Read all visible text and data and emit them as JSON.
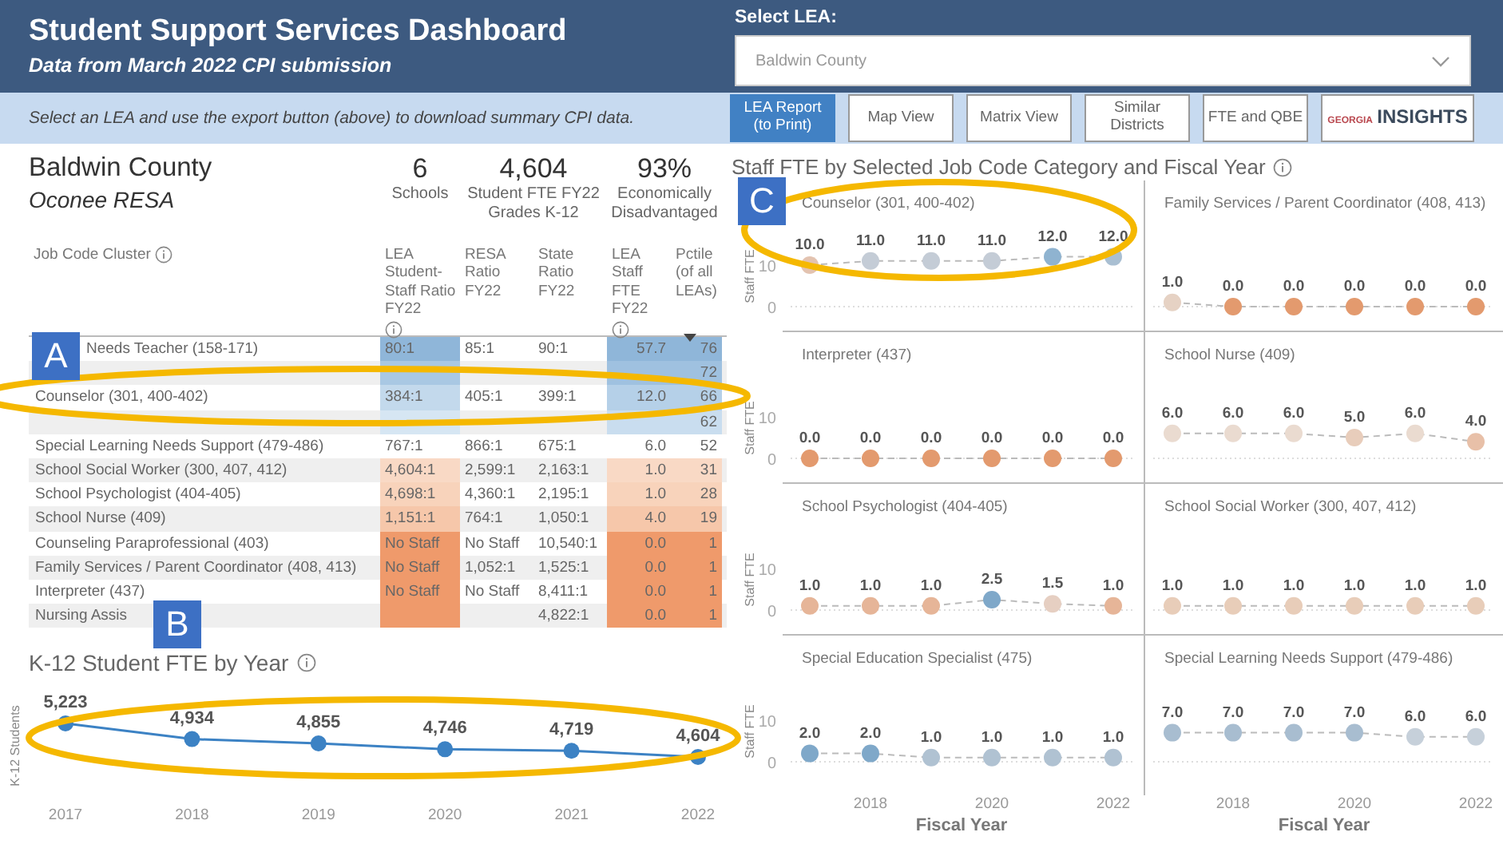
{
  "header": {
    "title": "Student Support Services Dashboard",
    "subtitle": "Data from March 2022 CPI submission"
  },
  "lea_select": {
    "label": "Select LEA:",
    "value": "Baldwin County"
  },
  "instructions": "Select an LEA and use the export button (above) to download summary CPI data.",
  "nav_buttons": [
    {
      "kind": "button",
      "label": "LEA Report (to Print)",
      "selected": true
    },
    {
      "kind": "button",
      "label": "Map View",
      "selected": false
    },
    {
      "kind": "button",
      "label": "Matrix View",
      "selected": false
    },
    {
      "kind": "button",
      "label": "Similar Districts",
      "selected": false
    },
    {
      "kind": "button",
      "label": "FTE and QBE",
      "selected": false
    },
    {
      "kind": "logo",
      "label_small": "GEORGIA",
      "label_large": "INSIGHTS",
      "selected": false
    }
  ],
  "summary": {
    "name": "Baldwin County",
    "resa": "Oconee RESA",
    "stats": [
      {
        "value": "6",
        "label": "Schools"
      },
      {
        "value": "4,604",
        "label": "Student FTE FY22 Grades K-12"
      },
      {
        "value": "93%",
        "label": "Economically Disadvantaged"
      }
    ]
  },
  "table": {
    "columns": [
      {
        "label": "Job Code Cluster",
        "info": true,
        "sorted": false
      },
      {
        "label": "LEA Student-Staff Ratio FY22",
        "info": true,
        "sorted": false
      },
      {
        "label": "RESA Ratio FY22",
        "info": false,
        "sorted": false
      },
      {
        "label": "State Ratio FY22",
        "info": false,
        "sorted": false
      },
      {
        "label": "LEA Staff FTE FY22",
        "info": true,
        "sorted": false
      },
      {
        "label": "Pctile (of all LEAs)",
        "info": false,
        "sorted": true
      }
    ],
    "rows": [
      {
        "cells": [
          {
            "text": "Needs Teacher (158-171)"
          },
          {
            "text": "80:1",
            "color": "#8fb6d9"
          },
          {
            "text": "85:1"
          },
          {
            "text": "90:1"
          },
          {
            "text": "57.7",
            "color": "#8fb6d9"
          },
          {
            "text": "76",
            "color": "#8fb6d9"
          }
        ]
      },
      {
        "cells": [
          {},
          {
            "color": "#a9c8e3"
          },
          {},
          {},
          {
            "color": "#9fc1e0"
          },
          {
            "text": "72",
            "color": "#9fc1e0"
          }
        ]
      },
      {
        "cells": [
          {
            "text": "Counselor (301, 400-402)"
          },
          {
            "text": "384:1",
            "color": "#c3d9ec"
          },
          {
            "text": "405:1"
          },
          {
            "text": "399:1"
          },
          {
            "text": "12.0",
            "color": "#b5d0e8"
          },
          {
            "text": "66",
            "color": "#b5d0e8"
          }
        ]
      },
      {
        "cells": [
          {},
          {
            "color": "#d6e6f3"
          },
          {},
          {},
          {
            "color": "#c9ddef"
          },
          {
            "text": "62",
            "color": "#c9ddef"
          }
        ]
      },
      {
        "cells": [
          {
            "text": "Special Learning Needs Support (479-486)"
          },
          {
            "text": "767:1",
            "color": "#ffffff"
          },
          {
            "text": "866:1"
          },
          {
            "text": "675:1"
          },
          {
            "text": "6.0",
            "color": "#ffffff"
          },
          {
            "text": "52",
            "color": "#ffffff"
          }
        ]
      },
      {
        "cells": [
          {
            "text": "School Social Worker (300, 407, 412)"
          },
          {
            "text": "4,604:1",
            "color": "#f9d9c5"
          },
          {
            "text": "2,599:1"
          },
          {
            "text": "2,163:1"
          },
          {
            "text": "1.0",
            "color": "#f9d9c5"
          },
          {
            "text": "31",
            "color": "#f9d9c5"
          }
        ]
      },
      {
        "cells": [
          {
            "text": "School Psychologist (404-405)"
          },
          {
            "text": "4,698:1",
            "color": "#f8d3bb"
          },
          {
            "text": "4,360:1"
          },
          {
            "text": "2,195:1"
          },
          {
            "text": "1.0",
            "color": "#f8d3bb"
          },
          {
            "text": "28",
            "color": "#f8d3bb"
          }
        ]
      },
      {
        "cells": [
          {
            "text": "School Nurse (409)"
          },
          {
            "text": "1,151:1",
            "color": "#f6c7aa"
          },
          {
            "text": "764:1"
          },
          {
            "text": "1,050:1"
          },
          {
            "text": "4.0",
            "color": "#f6c7aa"
          },
          {
            "text": "19",
            "color": "#f6c7aa"
          }
        ]
      },
      {
        "cells": [
          {
            "text": "Counseling Paraprofessional (403)"
          },
          {
            "text": "No Staff",
            "color": "#ef9a6b"
          },
          {
            "text": "No Staff"
          },
          {
            "text": "10,540:1"
          },
          {
            "text": "0.0",
            "color": "#ef9a6b"
          },
          {
            "text": "1",
            "color": "#ef9a6b"
          }
        ]
      },
      {
        "cells": [
          {
            "text": "Family Services / Parent Coordinator (408, 413)"
          },
          {
            "text": "No Staff",
            "color": "#ef9a6b"
          },
          {
            "text": "1,052:1"
          },
          {
            "text": "1,525:1"
          },
          {
            "text": "0.0",
            "color": "#ef9a6b"
          },
          {
            "text": "1",
            "color": "#ef9a6b"
          }
        ]
      },
      {
        "cells": [
          {
            "text": "Interpreter (437)"
          },
          {
            "text": "No Staff",
            "color": "#ef9a6b"
          },
          {
            "text": "No Staff"
          },
          {
            "text": "8,411:1"
          },
          {
            "text": "0.0",
            "color": "#ef9a6b"
          },
          {
            "text": "1",
            "color": "#ef9a6b"
          }
        ]
      },
      {
        "cells": [
          {
            "text": "Nursing Assis"
          },
          {
            "color": "#ef9a6b"
          },
          {},
          {
            "text": "4,822:1"
          },
          {
            "text": "0.0",
            "color": "#ef9a6b"
          },
          {
            "text": "1",
            "color": "#ef9a6b"
          }
        ]
      }
    ]
  },
  "k12_chart": {
    "chart_data": {
      "type": "line",
      "title": "K-12 Student FTE by Year",
      "ylabel": "K-12 Students",
      "categories": [
        "2017",
        "2018",
        "2019",
        "2020",
        "2021",
        "2022"
      ],
      "values": [
        5223,
        4934,
        4855,
        4746,
        4719,
        4604
      ],
      "color": "#3c82c4",
      "marker": "circle",
      "value_labels": [
        "5,223",
        "4,934",
        "4,855",
        "4,746",
        "4,719",
        "4,604"
      ]
    }
  },
  "staff_fte": {
    "title": "Staff FTE by Selected Job Code Category and Fiscal Year",
    "panels": [
      {
        "title": "Counselor (301, 400-402)",
        "y_axis": {
          "label": "Staff FTE",
          "ticks": [
            "10",
            "0"
          ]
        },
        "points": [
          {
            "label": "10.0",
            "color": "#e3c3b0"
          },
          {
            "label": "11.0",
            "color": "#c4ccd6"
          },
          {
            "label": "11.0",
            "color": "#c4ccd6"
          },
          {
            "label": "11.0",
            "color": "#c4ccd6"
          },
          {
            "label": "12.0",
            "color": "#8fb3d0"
          },
          {
            "label": "12.0",
            "color": "#a9bfd2"
          }
        ]
      },
      {
        "title": "Family Services / Parent Coordinator (408, 413)",
        "points": [
          {
            "label": "1.0",
            "color": "#e6d2c4"
          },
          {
            "label": "0.0",
            "color": "#e39a6e"
          },
          {
            "label": "0.0",
            "color": "#e39a6e"
          },
          {
            "label": "0.0",
            "color": "#e39a6e"
          },
          {
            "label": "0.0",
            "color": "#e39a6e"
          },
          {
            "label": "0.0",
            "color": "#e39a6e"
          }
        ]
      },
      {
        "title": "Interpreter (437)",
        "y_axis": {
          "label": "Staff FTE",
          "ticks": [
            "10",
            "0"
          ]
        },
        "points": [
          {
            "label": "0.0",
            "color": "#e39a6e"
          },
          {
            "label": "0.0",
            "color": "#e39a6e"
          },
          {
            "label": "0.0",
            "color": "#e39a6e"
          },
          {
            "label": "0.0",
            "color": "#e39a6e"
          },
          {
            "label": "0.0",
            "color": "#e39a6e"
          },
          {
            "label": "0.0",
            "color": "#e39a6e"
          }
        ]
      },
      {
        "title": "School Nurse (409)",
        "points": [
          {
            "label": "6.0",
            "color": "#eadbd0"
          },
          {
            "label": "6.0",
            "color": "#eadbd0"
          },
          {
            "label": "6.0",
            "color": "#eadbd0"
          },
          {
            "label": "5.0",
            "color": "#e8cdbb"
          },
          {
            "label": "6.0",
            "color": "#eadbd0"
          },
          {
            "label": "4.0",
            "color": "#e8c0a8"
          }
        ]
      },
      {
        "title": "School Psychologist (404-405)",
        "y_axis": {
          "label": "Staff FTE",
          "ticks": [
            "10",
            "0"
          ]
        },
        "points": [
          {
            "label": "1.0",
            "color": "#e6b598"
          },
          {
            "label": "1.0",
            "color": "#e6b598"
          },
          {
            "label": "1.0",
            "color": "#e6b598"
          },
          {
            "label": "2.5",
            "color": "#7fa8c9"
          },
          {
            "label": "1.5",
            "color": "#e6cfc2"
          },
          {
            "label": "1.0",
            "color": "#e6b598"
          }
        ]
      },
      {
        "title": "School Social Worker (300, 407, 412)",
        "points": [
          {
            "label": "1.0",
            "color": "#e8cdb9"
          },
          {
            "label": "1.0",
            "color": "#e8cdb9"
          },
          {
            "label": "1.0",
            "color": "#e8cdb9"
          },
          {
            "label": "1.0",
            "color": "#e8cdb9"
          },
          {
            "label": "1.0",
            "color": "#e8cdb9"
          },
          {
            "label": "1.0",
            "color": "#e8cdb9"
          }
        ]
      },
      {
        "title": "Special Education Specialist (475)",
        "y_axis": {
          "label": "Staff FTE",
          "ticks": [
            "10",
            "0"
          ]
        },
        "x_axis": {
          "label": "Fiscal Year",
          "ticks": [
            "2018",
            "2020",
            "2022"
          ]
        },
        "points": [
          {
            "label": "2.0",
            "color": "#7fa8c9"
          },
          {
            "label": "2.0",
            "color": "#7fa8c9"
          },
          {
            "label": "1.0",
            "color": "#b0c2d2"
          },
          {
            "label": "1.0",
            "color": "#b0c2d2"
          },
          {
            "label": "1.0",
            "color": "#b0c2d2"
          },
          {
            "label": "1.0",
            "color": "#b0c2d2"
          }
        ]
      },
      {
        "title": "Special Learning Needs Support (479-486)",
        "x_axis": {
          "label": "Fiscal Year",
          "ticks": [
            "2018",
            "2020",
            "2022"
          ]
        },
        "points": [
          {
            "label": "7.0",
            "color": "#a8bdd0"
          },
          {
            "label": "7.0",
            "color": "#a8bdd0"
          },
          {
            "label": "7.0",
            "color": "#a8bdd0"
          },
          {
            "label": "7.0",
            "color": "#a8bdd0"
          },
          {
            "label": "6.0",
            "color": "#c6d0da"
          },
          {
            "label": "6.0",
            "color": "#c6d0da"
          }
        ]
      }
    ]
  },
  "annotations": [
    {
      "label": "A"
    },
    {
      "label": "B"
    },
    {
      "label": "C"
    }
  ]
}
